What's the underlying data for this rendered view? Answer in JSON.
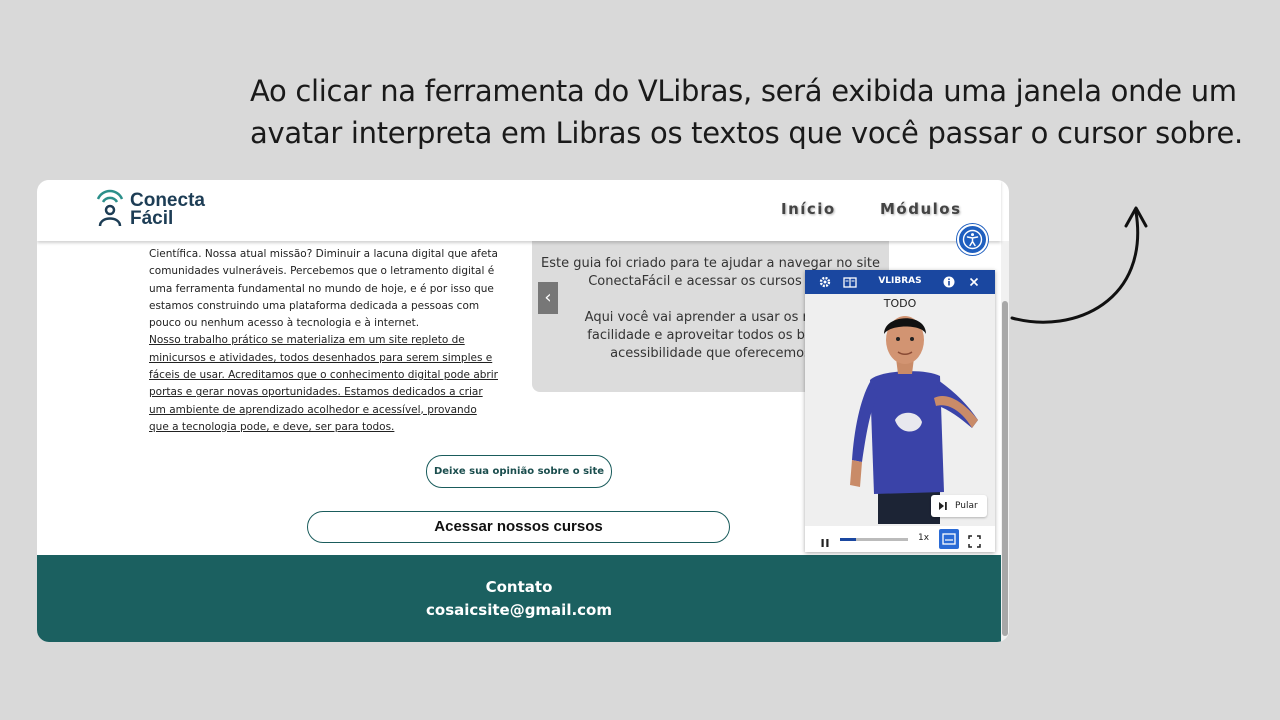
{
  "caption": {
    "line1": "Ao clicar na ferramenta do VLibras, será exibida uma janela onde um",
    "line2": "avatar interpreta em Libras os textos que você passar o cursor sobre."
  },
  "site": {
    "logo": {
      "line1": "Conecta",
      "line2": "Fácil"
    },
    "nav": [
      {
        "label": "Início"
      },
      {
        "label": "Módulos"
      }
    ],
    "about": {
      "plain": "Científica. Nossa atual missão? Diminuir a lacuna digital que afeta comunidades vulneráveis. Percebemos que o letramento digital é uma ferramenta fundamental no mundo de hoje, e é por isso que estamos construindo uma plataforma dedicada a pessoas com pouco ou nenhum acesso à tecnologia e à internet.",
      "underlined": "Nosso trabalho prático se materializa em um site repleto de minicursos e atividades, todos desenhados para serem simples e fáceis de usar. Acreditamos que o conhecimento digital pode abrir portas e gerar novas oportunidades. Estamos dedicados a criar um ambiente de aprendizado acolhedor e acessível, provando que a tecnologia pode, e deve, ser para todos."
    },
    "guide": {
      "text": "Este guia foi criado para te ajudar a navegar no site\nConectaFácil e acessar os cursos disp\n\nAqui você vai aprender a usar os recur\nfacilidade e aproveitar todos os benef\nacessibilidade que oferecemos"
    },
    "prev_label": "‹",
    "opinion_button": "Deixe sua opinião sobre o site",
    "courses_button": "Acessar nossos cursos",
    "footer": {
      "title": "Contato",
      "email": "cosaicsite@gmail.com"
    }
  },
  "vlibras": {
    "title": "VLIBRAS",
    "gloss": "TODO",
    "skip_label": "Pular",
    "speed": "1x",
    "progress": 0.23,
    "icons": [
      "gear-icon",
      "dictionary-icon",
      "info-icon",
      "close-icon",
      "pause-icon",
      "subtitles-icon",
      "fullscreen-icon",
      "skip-icon"
    ]
  },
  "colors": {
    "footer_bg": "#1b6060",
    "vlibras_blue": "#1a47a0",
    "accessibility_button": "#1f5fbf"
  }
}
